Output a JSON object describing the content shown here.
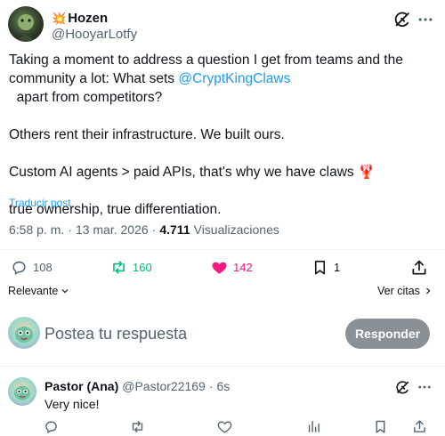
{
  "tweet": {
    "author": {
      "badge_emoji": "💥",
      "name": "Hozen",
      "handle": "@HooyarLotfy"
    },
    "text_line1": "Taking a moment to address a question I get from teams and the",
    "text_line2_prefix": "community a lot: What sets ",
    "mention": "@CryptKingClaws",
    "text_line2_suffix": "  apart from competitors?",
    "paragraph2": "Others rent their infrastructure. We built ours.",
    "paragraph3": "Custom AI agents > paid APIs, that's why we have claws",
    "paragraph3_emoji": "🦞",
    "paragraph4": "true ownership, true differentiation.",
    "translate_label": "Traducir post",
    "time": "6:58 p. m.",
    "separator": "·",
    "date": "13 mar. 2026",
    "views_count": "4.711",
    "views_label": "Visualizaciones",
    "stats": {
      "replies": "108",
      "reposts": "160",
      "likes": "142",
      "bookmarks": "1"
    },
    "colors": {
      "repost": "#00ba7c",
      "like": "#f91880",
      "link": "#1d9bf0"
    }
  },
  "sort": {
    "relevance_label": "Relevante",
    "quotes_label": "Ver citas"
  },
  "composer": {
    "placeholder": "Postea tu respuesta",
    "submit_label": "Responder"
  },
  "reply": {
    "name": "Pastor (Ana)",
    "handle": "@Pastor22169",
    "age": "6s",
    "text": "Very nice!"
  }
}
